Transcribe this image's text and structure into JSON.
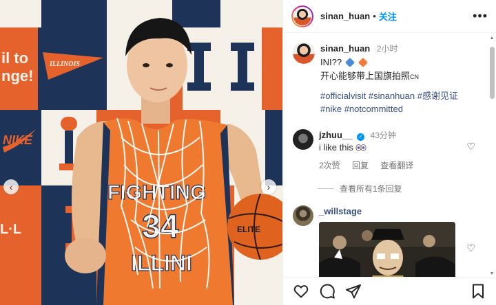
{
  "header": {
    "username": "sinan_huan",
    "dot": "•",
    "follow_label": "关注",
    "more_icon": "more-horizontal-icon"
  },
  "caption": {
    "username": "sinan_huan",
    "time": "2小时",
    "line1_text": "INI??",
    "line2_text": "开心能够带上国旗拍照",
    "line2_suffix": "CN",
    "hashtags_line1": [
      "#officialvisit",
      "#sinanhuan",
      "#感谢见证"
    ],
    "hashtags_line2": [
      "#nike",
      "#notcommitted"
    ]
  },
  "comments": [
    {
      "username": "jzhuu__",
      "verified": true,
      "time": "43分钟",
      "text": "i like this",
      "likes": "2次赞",
      "reply_label": "回复",
      "translate_label": "查看翻译",
      "view_replies": "查看所有1条回复"
    },
    {
      "username": "_willstage",
      "attachment": "gif"
    }
  ],
  "photo": {
    "jersey_top": "FIGHTING",
    "jersey_number": "34",
    "jersey_bottom": "ILLINI",
    "banner_text": "ILLINOIS",
    "prev_icon": "chevron-left-icon",
    "next_icon": "chevron-right-icon"
  },
  "actions": [
    "heart-icon",
    "comment-icon",
    "share-icon",
    "bookmark-icon"
  ],
  "colors": {
    "accent": "#0095f6",
    "link": "#385185",
    "illini_orange": "#e8612c",
    "illini_blue": "#13294b"
  }
}
